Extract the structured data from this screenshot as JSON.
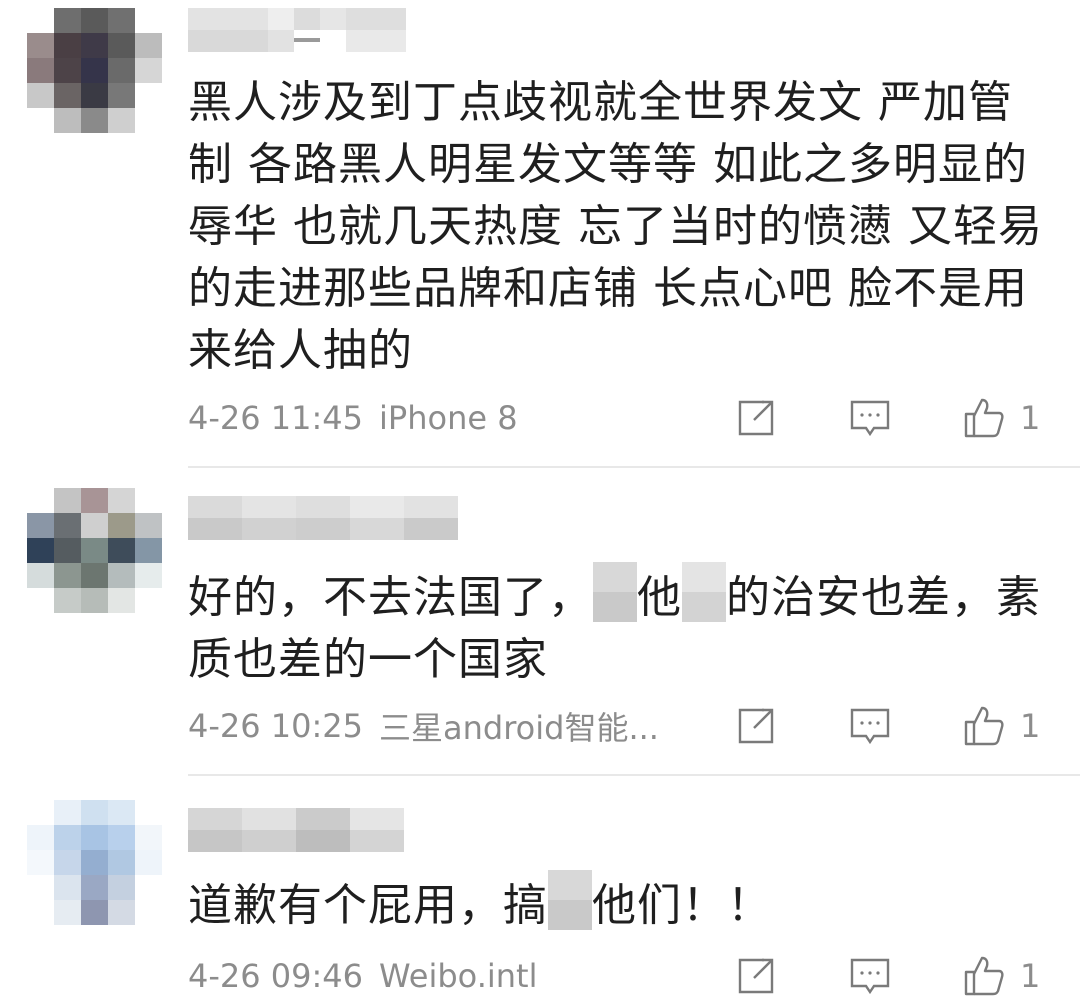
{
  "comments": [
    {
      "text_parts": [
        "黑人涉及到丁点歧视就全世界发文 严加管制 各路黑人明星发文等等 如此之多明显的辱华 也就几天热度 忘了当时的愤懑 又轻易的走进那些品牌和店铺 长点心吧 脸不是用来给人抽的"
      ],
      "time": "4-26 11:45",
      "device": "iPhone 8",
      "likes": "1"
    },
    {
      "text_a": "好的，不去法国了，",
      "text_b": "他",
      "text_c": "的治安也差，素质也差的一个国家",
      "time": "4-26 10:25",
      "device": "三星android智能...",
      "likes": "1"
    },
    {
      "text_a": "道歉有个屁用，搞",
      "text_b": "他们！！",
      "time": "4-26 09:46",
      "device": "Weibo.intl",
      "likes": "1"
    }
  ],
  "icons": {
    "share": "share-icon",
    "reply": "comment-icon",
    "like": "thumbs-up-icon"
  },
  "colors": {
    "meta_text": "#8c8c8c",
    "body_text": "#1f1f1f",
    "divider": "#e8e8e8"
  }
}
